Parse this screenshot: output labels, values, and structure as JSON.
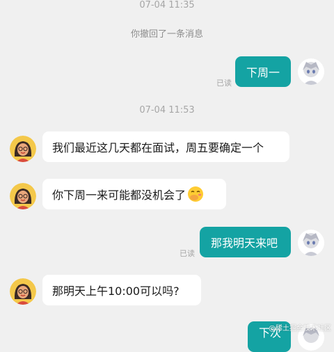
{
  "messages": [
    {
      "kind": "timestamp",
      "text": "07-04 11:35"
    },
    {
      "kind": "system",
      "text": "你撤回了一条消息"
    },
    {
      "kind": "outgoing",
      "text": "下周一",
      "status": "已读"
    },
    {
      "kind": "timestamp",
      "text": "07-04 11:53"
    },
    {
      "kind": "incoming",
      "text": "我们最近这几天都在面试，周五要确定一个"
    },
    {
      "kind": "incoming",
      "text": "你下周一来可能都没机会了",
      "emoji": "face-with-hand-over-mouth"
    },
    {
      "kind": "outgoing",
      "text": "那我明天来吧",
      "status": "已读"
    },
    {
      "kind": "incoming",
      "text": "那明天上午10:00可以吗?"
    },
    {
      "kind": "outgoing",
      "text": "下次"
    }
  ],
  "watermark": "@稀土掘金技术社区",
  "colors": {
    "background": "#f0f0f0",
    "outgoing_bubble": "#14a3a3",
    "incoming_bubble": "#ffffff",
    "meta_text": "#a6a6a6"
  },
  "icons": {
    "incoming_avatar": "woman-with-glasses-avatar",
    "outgoing_avatar": "anime-character-avatar"
  }
}
